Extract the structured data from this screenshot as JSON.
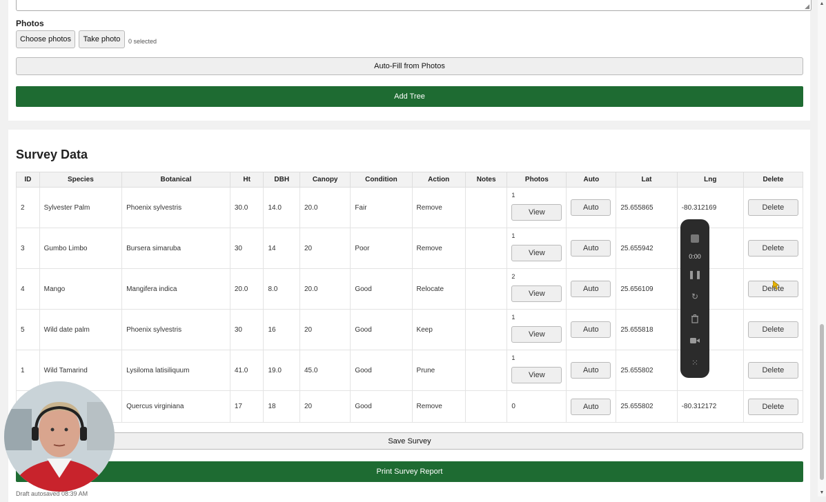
{
  "form": {
    "photos_label": "Photos",
    "choose_photos": "Choose photos",
    "take_photo": "Take photo",
    "selected": "0 selected",
    "autofill": "Auto-Fill from Photos",
    "add_tree": "Add Tree"
  },
  "survey": {
    "title": "Survey Data",
    "columns": [
      "ID",
      "Species",
      "Botanical",
      "Ht",
      "DBH",
      "Canopy",
      "Condition",
      "Action",
      "Notes",
      "Photos",
      "Auto",
      "Lat",
      "Lng",
      "Delete"
    ],
    "rows": [
      {
        "id": "2",
        "species": "Sylvester Palm",
        "botanical": "Phoenix sylvestris",
        "ht": "30.0",
        "dbh": "14.0",
        "canopy": "20.0",
        "condition": "Fair",
        "action": "Remove",
        "notes": "",
        "photos": "1",
        "lat": "25.655865",
        "lng": "-80.312169"
      },
      {
        "id": "3",
        "species": "Gumbo Limbo",
        "botanical": "Bursera simaruba",
        "ht": "30",
        "dbh": "14",
        "canopy": "20",
        "condition": "Poor",
        "action": "Remove",
        "notes": "",
        "photos": "1",
        "lat": "25.655942",
        "lng": "78"
      },
      {
        "id": "4",
        "species": "Mango",
        "botanical": "Mangifera indica",
        "ht": "20.0",
        "dbh": "8.0",
        "canopy": "20.0",
        "condition": "Good",
        "action": "Relocate",
        "notes": "",
        "photos": "2",
        "lat": "25.656109",
        "lng": "30"
      },
      {
        "id": "5",
        "species": "Wild date palm",
        "botanical": "Phoenix sylvestris",
        "ht": "30",
        "dbh": "16",
        "canopy": "20",
        "condition": "Good",
        "action": "Keep",
        "notes": "",
        "photos": "1",
        "lat": "25.655818",
        "lng": "08"
      },
      {
        "id": "1",
        "species": "Wild Tamarind",
        "botanical": "Lysiloma latisiliquum",
        "ht": "41.0",
        "dbh": "19.0",
        "canopy": "45.0",
        "condition": "Good",
        "action": "Prune",
        "notes": "",
        "photos": "1",
        "lat": "25.655802",
        "lng": "72"
      },
      {
        "id": "",
        "species": "",
        "botanical": "Quercus virginiana",
        "ht": "17",
        "dbh": "18",
        "canopy": "20",
        "condition": "Good",
        "action": "Remove",
        "notes": "",
        "photos": "0",
        "lat": "25.655802",
        "lng": "-80.312172"
      }
    ],
    "view_label": "View",
    "auto_label": "Auto",
    "delete_label": "Delete",
    "save": "Save Survey",
    "print": "Print Survey Report",
    "autosave": "Draft autosaved 08:39 AM"
  },
  "recorder": {
    "time": "0:00"
  }
}
